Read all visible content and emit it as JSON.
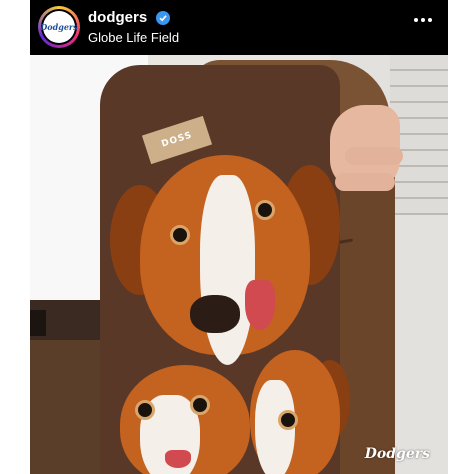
{
  "post": {
    "username": "dodgers",
    "verified": true,
    "location": "Globe Life Field",
    "more_icon": "more-horizontal-icon",
    "avatar_logo_text": "Dodgers"
  },
  "photo": {
    "subject": "suit jacket with dog-print lining",
    "lining_tag_text": "DOSS",
    "watermark_text": "Dodgers"
  },
  "colors": {
    "header_bg": "#000000",
    "header_text": "#ffffff",
    "verified_blue": "#3897f0",
    "dodgers_blue": "#1e4f9c"
  }
}
